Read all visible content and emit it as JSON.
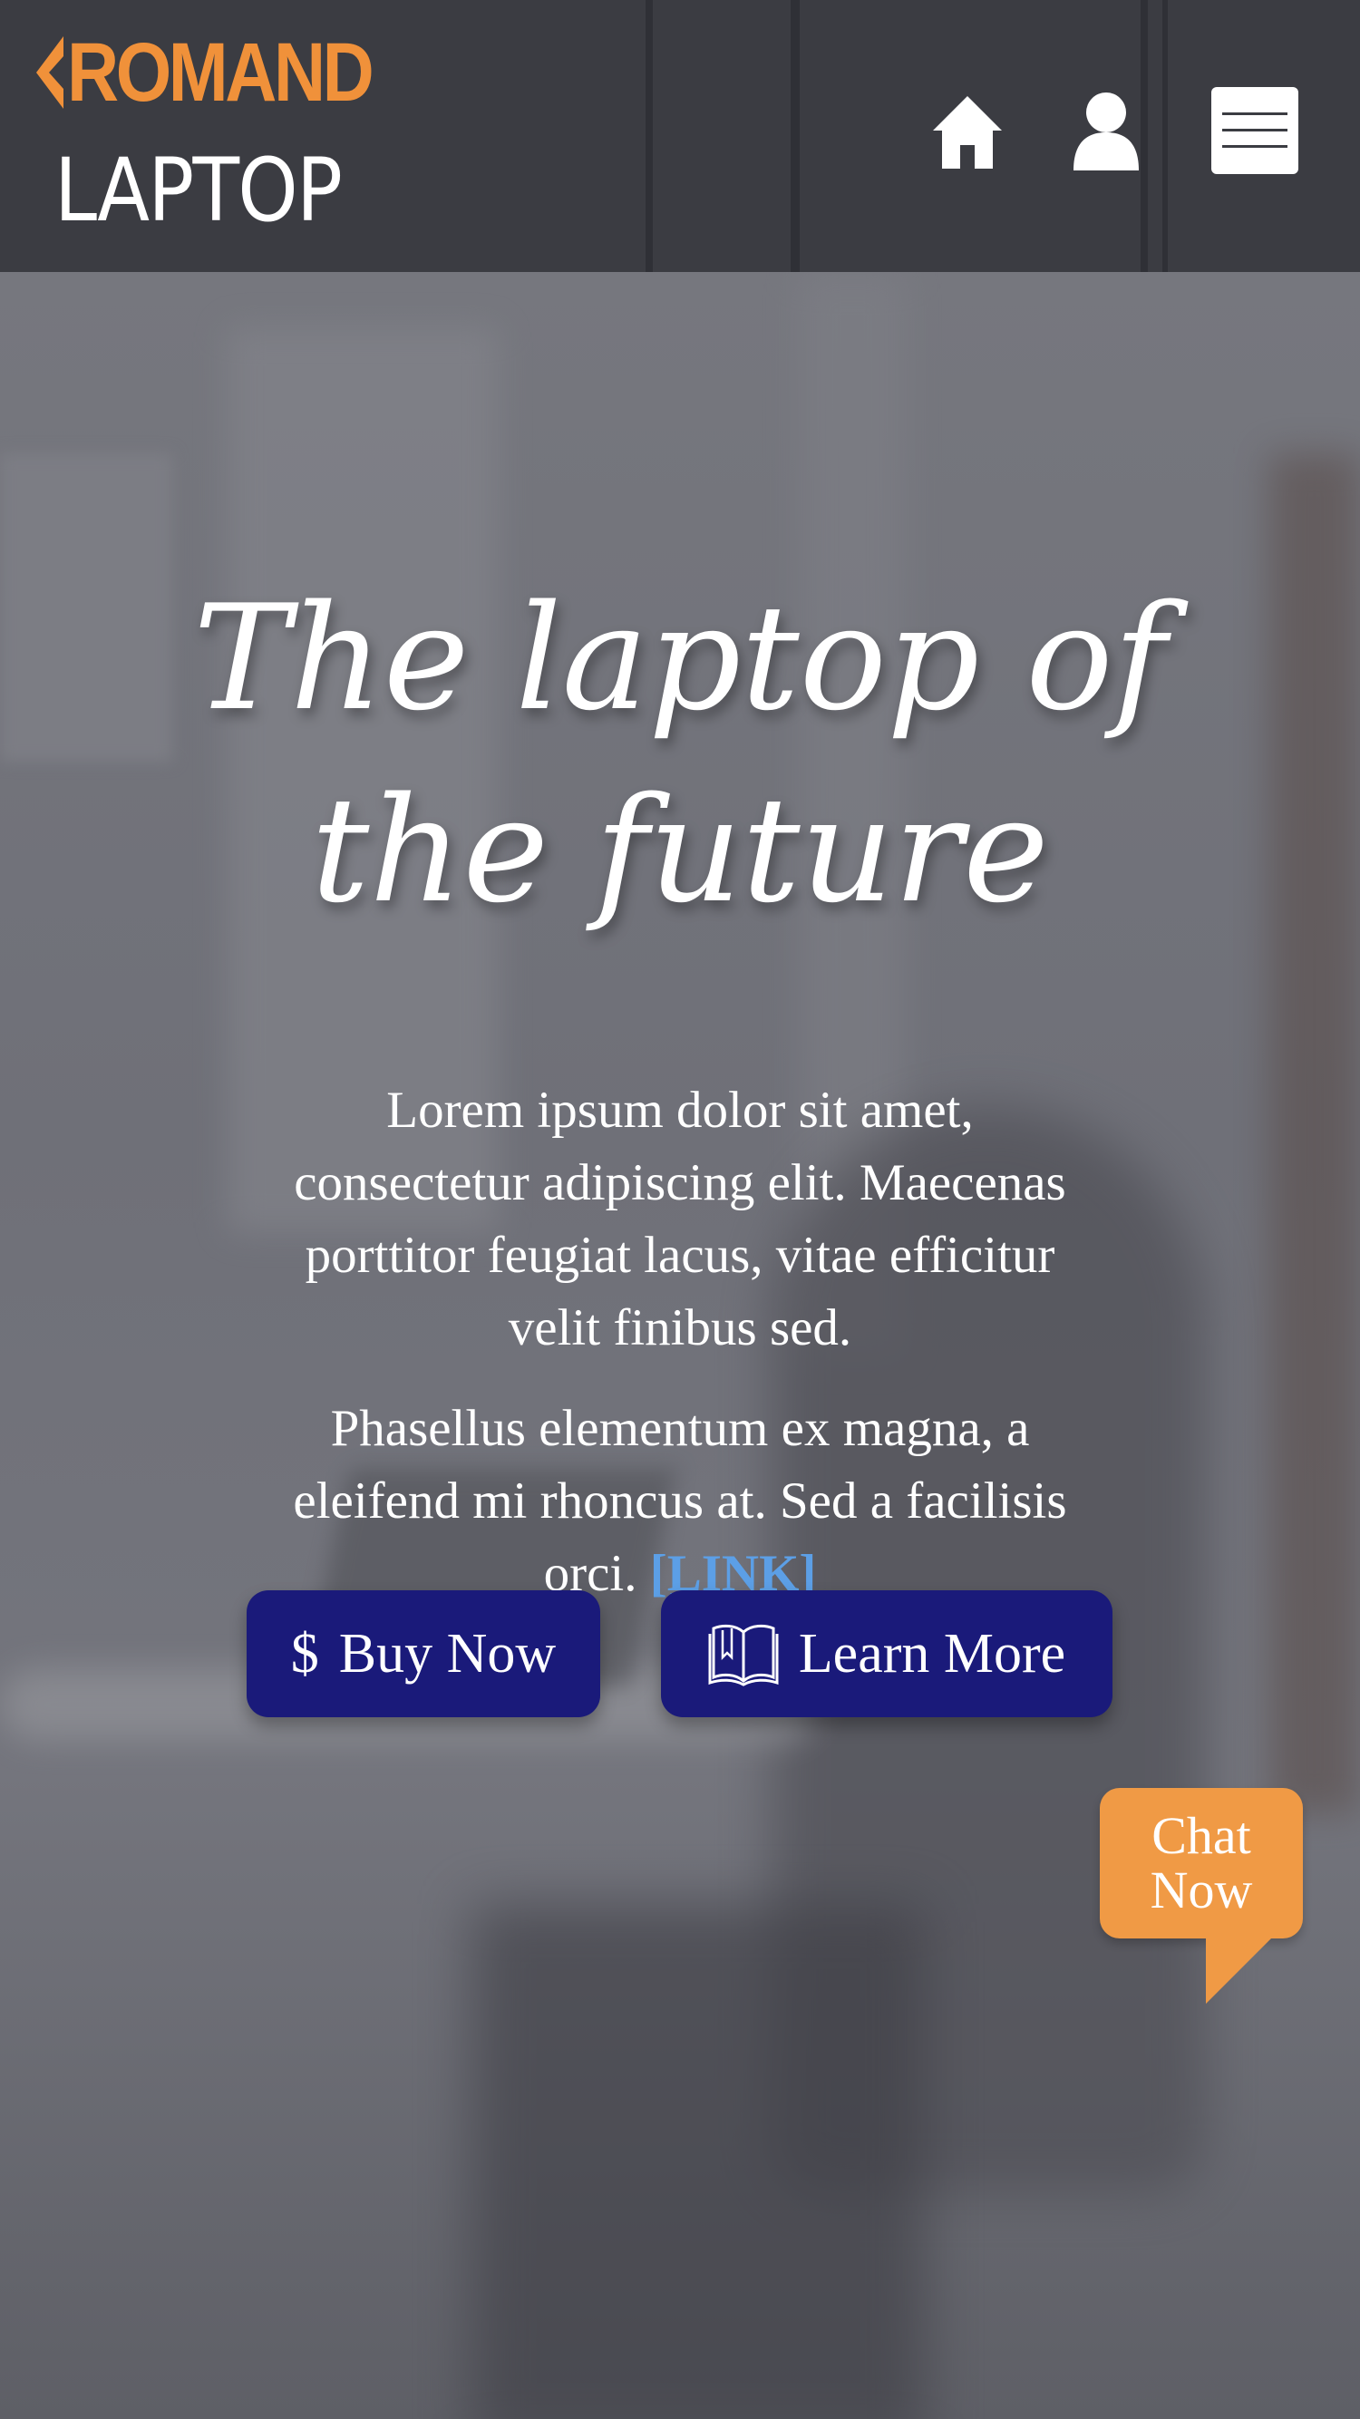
{
  "header": {
    "logo_brand": "ROMAND",
    "logo_sub": "LAPTOP",
    "icons": [
      "home-icon",
      "user-icon",
      "hamburger-menu-icon"
    ]
  },
  "hero": {
    "title": "The laptop of the future",
    "paragraph1": "Lorem ipsum dolor sit amet, consectetur adipiscing elit. Maecenas porttitor feugiat lacus, vitae efficitur velit finibus sed.",
    "paragraph2_text": "Phasellus elementum ex magna, a eleifend mi rhoncus at. Sed a facilisis orci.",
    "paragraph2_link": "[LINK]"
  },
  "buttons": {
    "buy_icon": "$",
    "buy_label": "Buy Now",
    "learn_icon": "book-icon",
    "learn_label": "Learn More"
  },
  "chat": {
    "line1": "Chat",
    "line2": "Now"
  },
  "colors": {
    "header_bg": "#3b3c42",
    "brand_orange": "#f0913a",
    "button_navy": "#1a1a7a",
    "link_blue": "#5c9fe6",
    "chat_orange": "#f09a45"
  }
}
